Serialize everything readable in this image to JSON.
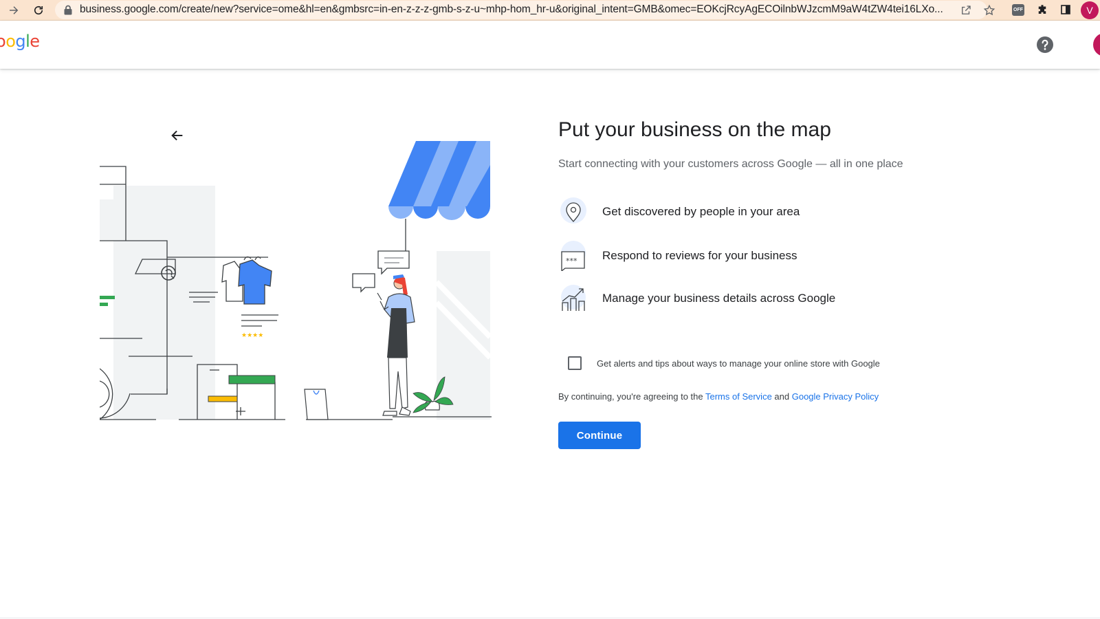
{
  "browser": {
    "url": "business.google.com/create/new?service=ome&hl=en&gmbsrc=in-en-z-z-z-gmb-s-z-u~mhp-hom_hr-u&original_intent=GMB&omec=EOKcjRcyAgECOilnbWJzcmM9aW4tZW4tei16LXo...",
    "extension_badge": "OFF",
    "profile_initial": "V",
    "icons": [
      "forward-icon",
      "reload-icon",
      "lock-icon",
      "share-icon",
      "star-icon",
      "extensions-icon",
      "side-panel-icon"
    ]
  },
  "header": {
    "logo_letters": [
      "o",
      "o",
      "g",
      "l",
      "e"
    ],
    "logo_colors": [
      "#ea4335",
      "#fbbc05",
      "#4285f4",
      "#34a853",
      "#ea4335"
    ],
    "help_icon": "help-icon"
  },
  "main": {
    "back_icon": "arrow-back-icon",
    "title": "Put your business on the map",
    "subtitle": "Start connecting with your customers across Google — all in one place",
    "features": [
      {
        "icon": "location-pin-icon",
        "text": "Get discovered by people in your area"
      },
      {
        "icon": "review-bubble-icon",
        "text": "Respond to reviews for your business"
      },
      {
        "icon": "chart-growth-icon",
        "text": "Manage your business details across Google"
      }
    ],
    "optin_label": "Get alerts and tips about ways to manage your online store with Google",
    "optin_checked": false,
    "legal": {
      "prefix": "By continuing, you're agreeing to the ",
      "terms_link": "Terms of Service",
      "conjunction": " and ",
      "privacy_link": "Google Privacy Policy"
    },
    "continue_label": "Continue"
  },
  "colors": {
    "accent": "#1a73e8",
    "awning_dark": "#4285f4",
    "awning_light": "#8ab4f8",
    "green": "#34a853",
    "yellow": "#fbbc05",
    "red": "#ea4335"
  }
}
